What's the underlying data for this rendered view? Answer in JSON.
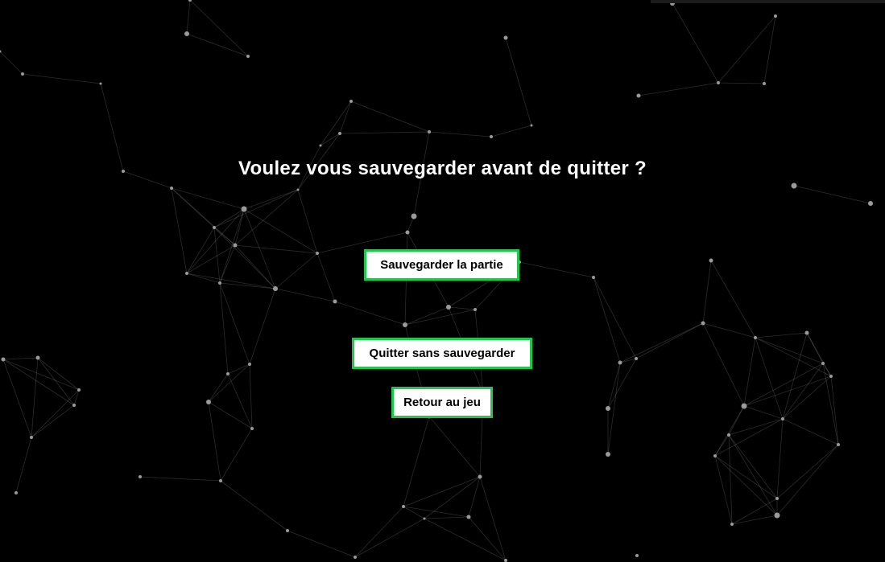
{
  "dialog": {
    "title": "Voulez vous sauvegarder avant de quitter ?",
    "buttons": {
      "save_label": "Sauvegarder la partie",
      "quit_label": "Quitter sans sauvegarder",
      "back_label": "Retour au jeu"
    }
  },
  "colors": {
    "background": "#000000",
    "button_border": "#1fc74a",
    "button_background": "#ffffff",
    "title_text": "#ffffff",
    "network_line": "#ffffff",
    "network_node": "#9a9a9a"
  }
}
